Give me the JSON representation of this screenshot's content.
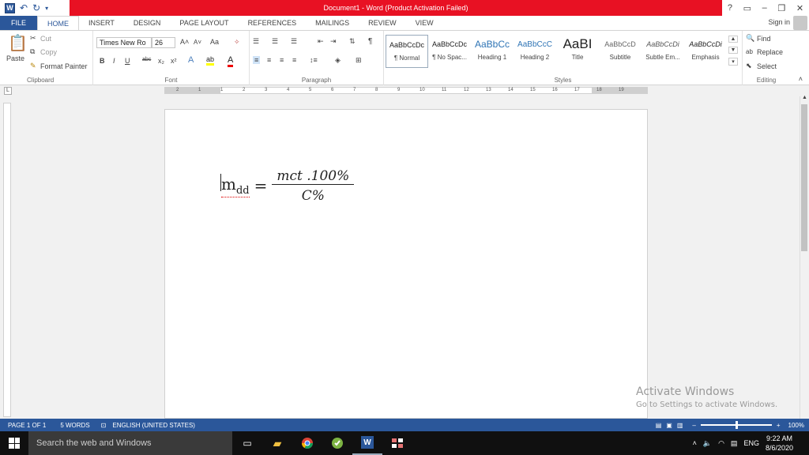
{
  "window": {
    "title": "Document1 - Word (Product Activation Failed)",
    "controls": [
      "?",
      "▭",
      "–",
      "❐",
      "✕"
    ]
  },
  "ribbon_tabs": [
    "FILE",
    "HOME",
    "INSERT",
    "DESIGN",
    "PAGE LAYOUT",
    "REFERENCES",
    "MAILINGS",
    "REVIEW",
    "VIEW"
  ],
  "active_tab": "HOME",
  "sign_in": "Sign in",
  "clipboard": {
    "cut": "Cut",
    "copy": "Copy",
    "paste": "Paste",
    "format_painter": "Format Painter",
    "label": "Clipboard"
  },
  "font": {
    "name": "Times New Ro",
    "size": "26",
    "label": "Font",
    "case": "Aa",
    "bold": "B",
    "italic": "I",
    "underline": "U",
    "strike": "abc",
    "subscript": "x₂",
    "superscript": "x²"
  },
  "paragraph": {
    "label": "Paragraph",
    "pilcrow": "¶"
  },
  "styles": {
    "label": "Styles",
    "items": [
      {
        "preview": "AaBbCcDc",
        "name": "¶ Normal"
      },
      {
        "preview": "AaBbCcDc",
        "name": "¶ No Spac..."
      },
      {
        "preview": "AaBbCc",
        "name": "Heading 1"
      },
      {
        "preview": "AaBbCcC",
        "name": "Heading 2"
      },
      {
        "preview": "AaBI",
        "name": "Title"
      },
      {
        "preview": "AaBbCcD",
        "name": "Subtitle"
      },
      {
        "preview": "AaBbCcDi",
        "name": "Subtle Em..."
      },
      {
        "preview": "AaBbCcDi",
        "name": "Emphasis"
      }
    ]
  },
  "editing": {
    "label": "Editing",
    "find": "Find",
    "replace": "Replace",
    "select": "Select"
  },
  "ruler": {
    "ticks": [
      "2",
      "1",
      "1",
      "2",
      "3",
      "4",
      "5",
      "6",
      "7",
      "8",
      "9",
      "10",
      "11",
      "12",
      "13",
      "14",
      "15",
      "16",
      "17",
      "18",
      "19"
    ]
  },
  "document": {
    "lhs": "m",
    "lhs_sub": "dd",
    "equals": "=",
    "numerator": "mct .100%",
    "denominator": "C%"
  },
  "watermark": {
    "line1": "Activate Windows",
    "line2": "Go to Settings to activate Windows."
  },
  "status": {
    "page": "PAGE 1 OF 1",
    "words": "5 WORDS",
    "language": "ENGLISH (UNITED STATES)",
    "zoom": "100%",
    "zoom_minus": "–",
    "zoom_plus": "+"
  },
  "taskbar": {
    "search_placeholder": "Search the web and Windows",
    "language": "ENG",
    "time": "9:22 AM",
    "date": "8/6/2020"
  }
}
